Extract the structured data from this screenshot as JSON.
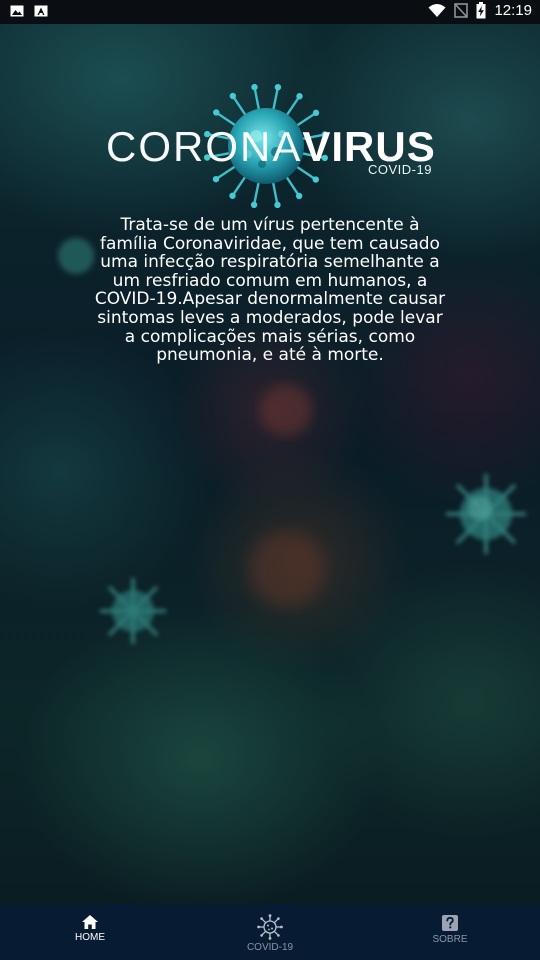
{
  "status_bar": {
    "time": "12:19",
    "left_icons": [
      "image-icon",
      "a-app-icon"
    ],
    "right_icons": [
      "wifi-icon",
      "no-signal-icon",
      "battery-charging-icon"
    ]
  },
  "logo": {
    "corona": "CORONA",
    "virus": "VIRUS",
    "subtitle": "COVID-19"
  },
  "description": "Trata-se de um vírus pertencente à família Coronaviridae, que tem causado uma infecção respiratória semelhante a um resfriado comum em humanos, a COVID-19.Apesar denormalmente causar sintomas leves a moderados, pode levar a complicações mais sérias, como pneumonia, e até à morte.",
  "bottom_nav": {
    "items": [
      {
        "label": "HOME",
        "icon": "home-icon",
        "active": true
      },
      {
        "label": "COVID-19",
        "icon": "virus-icon",
        "active": false
      },
      {
        "label": "SOBRE",
        "icon": "help-icon",
        "active": false
      }
    ]
  },
  "colors": {
    "background": "#0a1c27",
    "nav_background": "#071b33",
    "accent": "#3ec6d0",
    "text": "#ffffff",
    "inactive": "#8a96a8"
  }
}
